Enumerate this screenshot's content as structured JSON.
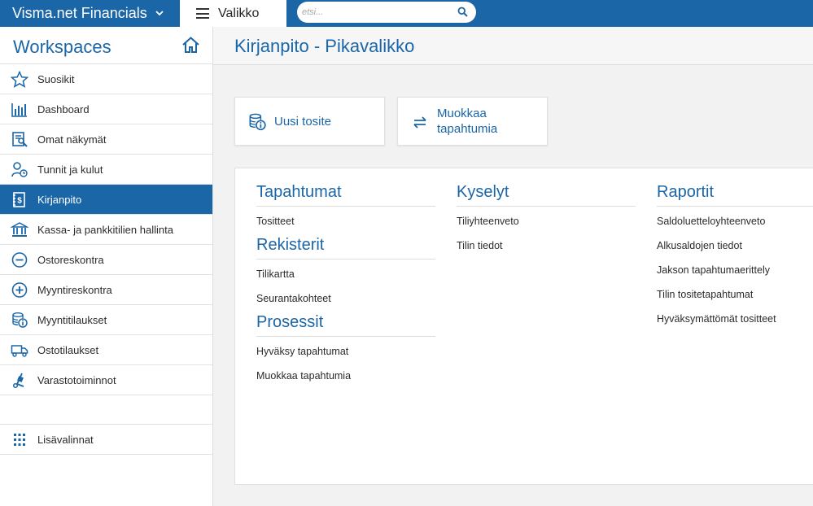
{
  "topbar": {
    "brand": "Visma.net Financials",
    "menu_label": "Valikko",
    "search_placeholder": "etsi..."
  },
  "sidebar": {
    "title": "Workspaces",
    "items": [
      {
        "label": "Suosikit",
        "icon": "star-icon"
      },
      {
        "label": "Dashboard",
        "icon": "bar-chart-icon"
      },
      {
        "label": "Omat näkymät",
        "icon": "custom-view-icon"
      },
      {
        "label": "Tunnit ja kulut",
        "icon": "time-expense-icon"
      },
      {
        "label": "Kirjanpito",
        "icon": "ledger-icon",
        "active": true
      },
      {
        "label": "Kassa- ja pankkitilien hallinta",
        "icon": "bank-icon"
      },
      {
        "label": "Ostoreskontra",
        "icon": "minus-circle-icon"
      },
      {
        "label": "Myyntireskontra",
        "icon": "plus-circle-icon"
      },
      {
        "label": "Myyntitilaukset",
        "icon": "coins-info-icon"
      },
      {
        "label": "Ostotilaukset",
        "icon": "truck-icon"
      },
      {
        "label": "Varastotoiminnot",
        "icon": "hand-truck-icon"
      }
    ],
    "more": {
      "label": "Lisävalinnat",
      "icon": "grid-icon"
    }
  },
  "main": {
    "title": "Kirjanpito - Pikavalikko",
    "quick_actions": [
      {
        "label": "Uusi tosite",
        "icon": "coins-info-icon"
      },
      {
        "label": "Muokkaa tapahtumia",
        "icon": "swap-arrows-icon"
      }
    ],
    "sections": {
      "tapahtumat": {
        "title": "Tapahtumat",
        "links": [
          "Tositteet"
        ]
      },
      "rekisterit": {
        "title": "Rekisterit",
        "links": [
          "Tilikartta",
          "Seurantakohteet"
        ]
      },
      "prosessit": {
        "title": "Prosessit",
        "links": [
          "Hyväksy tapahtumat",
          "Muokkaa tapahtumia"
        ]
      },
      "kyselyt": {
        "title": "Kyselyt",
        "links": [
          "Tiliyhteenveto",
          "Tilin tiedot"
        ]
      },
      "raportit": {
        "title": "Raportit",
        "links": [
          "Saldoluetteloyhteenveto",
          "Alkusaldojen tiedot",
          "Jakson tapahtumaerittely",
          "Tilin tositetapahtumat",
          "Hyväksymättömät tositteet"
        ]
      }
    }
  },
  "colors": {
    "accent": "#1a66a7",
    "background": "#f2f2f2"
  }
}
